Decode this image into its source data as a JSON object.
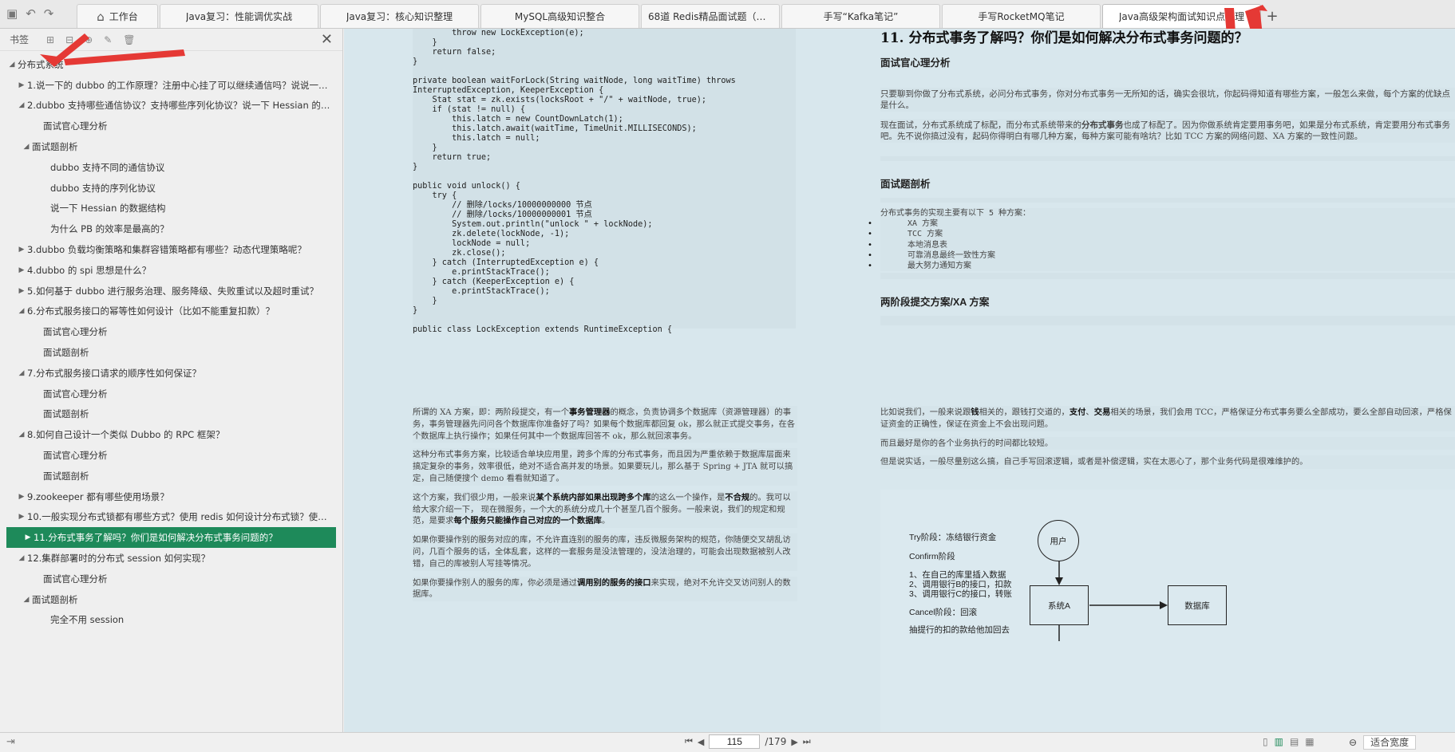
{
  "toolbar": {
    "save_icon": "save-icon",
    "undo_icon": "undo-icon",
    "redo_icon": "redo-icon"
  },
  "tabs": {
    "home": "工作台",
    "items": [
      "Java复习：性能调优实战",
      "Java复习：核心知识整理",
      "MySQL高级知识整合",
      "68道 Redis精品面试题（带解...",
      "手写“Kafka笔记”",
      "手写RocketMQ笔记",
      "Java高级架构面试知识点整理"
    ],
    "new_tab": "+"
  },
  "sidebar": {
    "title": "书签",
    "close": "✕",
    "tree": [
      {
        "label": "分布式系统",
        "caret": "◢",
        "level": "l0"
      },
      {
        "label": "1.说一下的 dubbo 的工作原理？注册中心挂了可以继续通信吗？说说一次 rpc 请...",
        "caret": "▶",
        "level": "l1"
      },
      {
        "label": "2.dubbo 支持哪些通信协议？支持哪些序列化协议？说一下 Hessian 的数据结构？...",
        "caret": "◢",
        "level": "l1"
      },
      {
        "label": "面试官心理分析",
        "caret": "",
        "level": "l2n"
      },
      {
        "label": "面试题剖析",
        "caret": "◢",
        "level": "l2"
      },
      {
        "label": "dubbo 支持不同的通信协议",
        "caret": "",
        "level": "l3"
      },
      {
        "label": "dubbo 支持的序列化协议",
        "caret": "",
        "level": "l3"
      },
      {
        "label": "说一下 Hessian 的数据结构",
        "caret": "",
        "level": "l3"
      },
      {
        "label": "为什么 PB 的效率是最高的？",
        "caret": "",
        "level": "l3"
      },
      {
        "label": "3.dubbo 负载均衡策略和集群容错策略都有哪些？动态代理策略呢？",
        "caret": "▶",
        "level": "l1"
      },
      {
        "label": "4.dubbo 的 spi 思想是什么？",
        "caret": "▶",
        "level": "l1"
      },
      {
        "label": "5.如何基于 dubbo 进行服务治理、服务降级、失败重试以及超时重试？",
        "caret": "▶",
        "level": "l1"
      },
      {
        "label": "6.分布式服务接口的幂等性如何设计（比如不能重复扣款）？",
        "caret": "◢",
        "level": "l1"
      },
      {
        "label": "面试官心理分析",
        "caret": "",
        "level": "l2n"
      },
      {
        "label": "面试题剖析",
        "caret": "",
        "level": "l2n"
      },
      {
        "label": "7.分布式服务接口请求的顺序性如何保证？",
        "caret": "◢",
        "level": "l1"
      },
      {
        "label": "面试官心理分析",
        "caret": "",
        "level": "l2n"
      },
      {
        "label": "面试题剖析",
        "caret": "",
        "level": "l2n"
      },
      {
        "label": "8.如何自己设计一个类似 Dubbo 的 RPC 框架？",
        "caret": "◢",
        "level": "l1"
      },
      {
        "label": "面试官心理分析",
        "caret": "",
        "level": "l2n"
      },
      {
        "label": "面试题剖析",
        "caret": "",
        "level": "l2n"
      },
      {
        "label": "9.zookeeper 都有哪些使用场景？",
        "caret": "▶",
        "level": "l1"
      },
      {
        "label": "10.一般实现分布式锁都有哪些方式？使用 redis 如何设计分布式锁？使用 zk 来设...",
        "caret": "▶",
        "level": "l1"
      },
      {
        "label": "11.分布式事务了解吗？你们是如何解决分布式事务问题的？",
        "caret": "▶",
        "level": "l1",
        "selected": true
      },
      {
        "label": "12.集群部署时的分布式 session 如何实现？",
        "caret": "◢",
        "level": "l1"
      },
      {
        "label": "面试官心理分析",
        "caret": "",
        "level": "l2n"
      },
      {
        "label": "面试题剖析",
        "caret": "◢",
        "level": "l2"
      },
      {
        "label": "完全不用 session",
        "caret": "",
        "level": "l3"
      }
    ]
  },
  "code": [
    "        throw new LockException(e);",
    "    }",
    "    return false;",
    "}",
    "",
    "private boolean waitForLock(String waitNode, long waitTime) throws",
    "InterruptedException, KeeperException {",
    "    Stat stat = zk.exists(locksRoot + \"/\" + waitNode, true);",
    "    if (stat != null) {",
    "        this.latch = new CountDownLatch(1);",
    "        this.latch.await(waitTime, TimeUnit.MILLISECONDS);",
    "        this.latch = null;",
    "    }",
    "    return true;",
    "}",
    "",
    "public void unlock() {",
    "    try {",
    "        // 删除/locks/10000000000 节点",
    "        // 删除/locks/10000000001 节点",
    "        System.out.println(\"unlock \" + lockNode);",
    "        zk.delete(lockNode, -1);",
    "        lockNode = null;",
    "        zk.close();",
    "    } catch (InterruptedException e) {",
    "        e.printStackTrace();",
    "    } catch (KeeperException e) {",
    "        e.printStackTrace();",
    "    }",
    "}",
    "",
    "public class LockException extends RuntimeException {"
  ],
  "right_top": {
    "title": "11. 分布式事务了解吗？你们是如何解决分布式事务问题的？",
    "h_mind": "面试官心理分析",
    "p_mind1": "只要聊到你做了分布式系统，必问分布式事务，你对分布式事务一无所知的话，确实会很坑，你起码得知道有哪些方案，一般怎么来做，每个方案的优缺点是什么。",
    "p_mind2a": "现在面试，分布式系统成了标配，而分布式系统带来的",
    "p_mind2b": "分布式事务",
    "p_mind2c": "也成了标配了。因为你做系统肯定要用事务吧，如果是分布式系统，肯定要用分布式事务吧。先不说你搞过没有，起码你得明白有哪几种方案，每种方案可能有啥坑？比如 TCC 方案的网络问题、XA 方案的一致性问题。",
    "h_analysis": "面试题剖析",
    "list_intro": "分布式事务的实现主要有以下 5 种方案：",
    "list": [
      "XA 方案",
      "TCC 方案",
      "本地消息表",
      "可靠消息最终一致性方案",
      "最大努力通知方案"
    ],
    "h_xa": "两阶段提交方案/XA 方案"
  },
  "lower_left": {
    "p1a": "所谓的 XA 方案，即：两阶段提交，有一个",
    "p1b": "事务管理器",
    "p1c": "的概念，负责协调多个数据库（资源管理器）的事务，事务管理器先问问各个数据库你准备好了吗？如果每个数据库都回复 ok，那么就正式提交事务，在各个数据库上执行操作；如果任何其中一个数据库回答不 ok，那么就回滚事务。",
    "p2": "这种分布式事务方案，比较适合单块应用里，跨多个库的分布式事务，而且因为严重依赖于数据库层面来搞定复杂的事务，效率很低，绝对不适合高并发的场景。如果要玩儿，那么基于 Spring + JTA 就可以搞定，自己随便搜个 demo 看看就知道了。",
    "p3a": "这个方案，我们很少用，一般来说",
    "p3b": "某个系统内部如果出现跨多个库",
    "p3c": "的这么一个操作，是",
    "p3d": "不合规",
    "p3e": "的。我可以给大家介绍一下， 现在微服务，一个大的系统分成几十个甚至几百个服务。一般来说，我们的规定和规范，是要求",
    "p3f": "每个服务只能操作自己对应的一个数据库",
    "p3g": "。",
    "p4": "如果你要操作别的服务对应的库，不允许直连别的服务的库，违反微服务架构的规范，你随便交叉胡乱访问，几百个服务的话，全体乱套，这样的一套服务是没法管理的，没法治理的，可能会出现数据被别人改错，自己的库被别人写挂等情况。",
    "p5a": "如果你要操作别人的服务的库，你必须是通过",
    "p5b": "调用别的服务的接口",
    "p5c": "来实现，绝对不允许交叉访问别人的数据库。"
  },
  "lower_right": {
    "p1a": "比如说我们，一般来说跟",
    "p1b": "钱",
    "p1c": "相关的，跟钱打交道的，",
    "p1d": "支付",
    "p1e": "、",
    "p1f": "交易",
    "p1g": "相关的场景，我们会用 TCC，严格保证分布式事务要么全部成功，要么全部自动回滚，严格保证资金的正确性，保证在资金上不会出现问题。",
    "p2": "而且最好是你的各个业务执行的时间都比较短。",
    "p3": "但是说实话，一般尽量别这么搞，自己手写回滚逻辑，或者是补偿逻辑，实在太恶心了，那个业务代码是很难维护的。"
  },
  "diagram": {
    "try_label": "Try阶段：冻结银行资金",
    "confirm_label": "Confirm阶段",
    "step1": "1、在自己的库里插入数据",
    "step2": "2、调用银行B的接口，扣款",
    "step3": "3、调用银行C的接口，转账",
    "cancel_label": "Cancel阶段：回滚",
    "cancel_more": "抽提行的扣的款给他加回去",
    "user": "用户",
    "system_a": "系统A",
    "database": "数据库"
  },
  "status": {
    "page_current": "115",
    "page_total": "/179",
    "zoom_label": "适合宽度"
  }
}
